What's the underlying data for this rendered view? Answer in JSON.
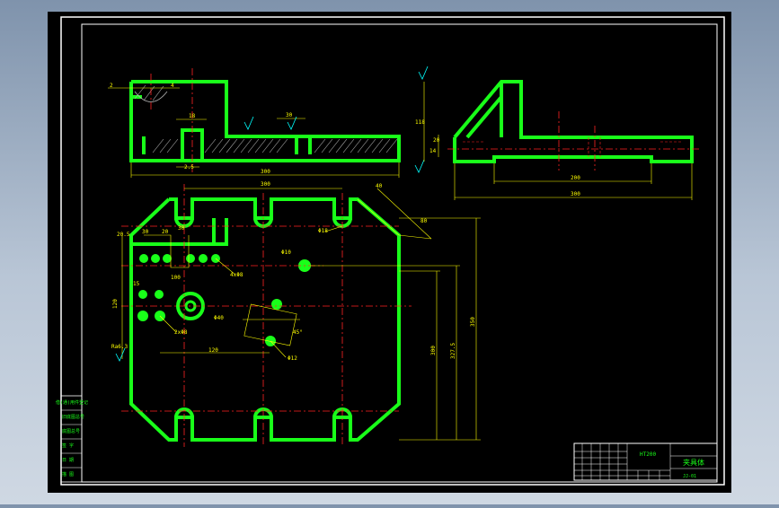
{
  "colors": {
    "sheet_background": "#000000",
    "border": "#ffffff",
    "part_outline": "#19ff19",
    "dimension": "#ffff00",
    "centerline": "#ff2222",
    "hatch": "#b4b4b4",
    "annotation": "#00ffff",
    "viewport_background": "#9aabc0"
  },
  "top_view": {
    "dim_width": "300",
    "dim_left": "2",
    "dim_right": "4",
    "dim_slot": "18",
    "dim_step": "2.5",
    "dim_height": "30"
  },
  "side_view": {
    "dim_height": "118",
    "dim_offset": "20",
    "dim_step": "14",
    "dim_bottom": "300",
    "dim_inner": "200"
  },
  "plan_view": {
    "dim_top_span": "300",
    "dim_offset": "40",
    "dim_slot": "Φ18",
    "dim_right": "80",
    "dim_left_top": "20.5",
    "dim_row_a": "30",
    "dim_row_b": "20",
    "dim_row_c": "30",
    "dim_hole_a": "4xΦ8",
    "dim_hole_b": "Φ10",
    "dim_center_h": "120",
    "dim_center_w": "100",
    "dim_bore": "Φ40",
    "dim_angle": "45°",
    "dim_small": "2xΦ8",
    "dim_mid": "15",
    "dim_height_a": "300",
    "dim_height_b": "327.5",
    "dim_height_c": "350",
    "dim_bottom_h": "120",
    "dim_hole_c": "Φ12",
    "dim_left_note": "Ra6.3"
  },
  "left_table": {
    "rows": [
      "借(通)用件登记",
      "旧底图总号",
      "底图总号",
      "签 字",
      "日 期",
      "描 图"
    ]
  },
  "title_block": {
    "title": "夹具体",
    "material": "HT200",
    "code": "JJ-01"
  }
}
